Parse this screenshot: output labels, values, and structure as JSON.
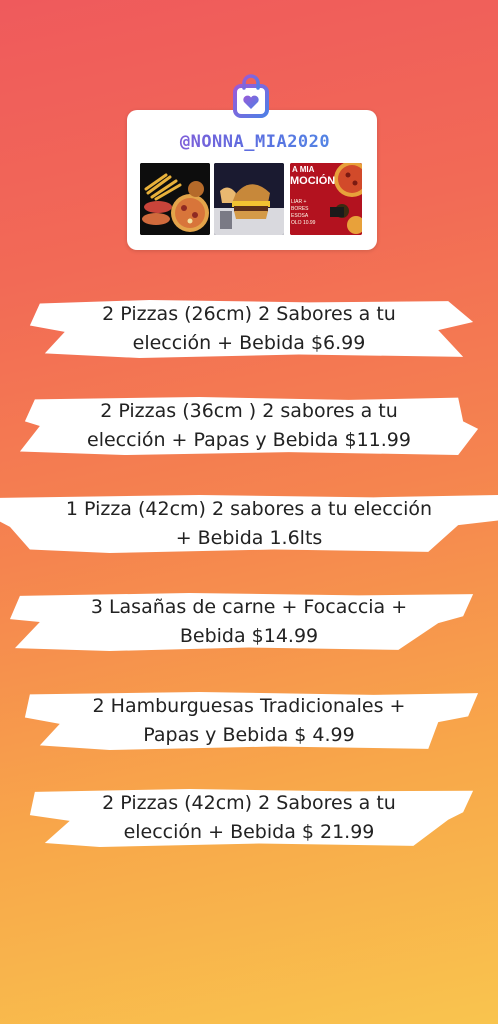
{
  "sticker": {
    "handle": "@NONNA_MIA2020",
    "images": [
      {
        "name": "fries-and-pizza-photo"
      },
      {
        "name": "hamburger-photo"
      },
      {
        "name": "promo-flyer",
        "label_top": "A MIA",
        "label_main": "MOCIÓN",
        "small_lines": [
          "LIAR +",
          "BORES",
          "ESOSA",
          "OLO 10.99"
        ]
      }
    ],
    "icon": "shopping-bag-heart-icon"
  },
  "offers": [
    {
      "lines": [
        "2 Pizzas (26cm) 2 Sabores a tu",
        "elección + Bebida  $6.99"
      ]
    },
    {
      "lines": [
        "2 Pizzas (36cm ) 2 sabores a tu",
        "elección + Papas y Bebida  $11.99"
      ]
    },
    {
      "lines": [
        "1 Pizza (42cm) 2 sabores a tu elección",
        "+ Bebida 1.6lts"
      ]
    },
    {
      "lines": [
        "3 Lasañas de carne + Focaccia +",
        "Bebida $14.99"
      ]
    },
    {
      "lines": [
        "2 Hamburguesas Tradicionales +",
        "Papas y Bebida $ 4.99"
      ]
    },
    {
      "lines": [
        "2 Pizzas (42cm) 2 Sabores a tu",
        "elección + Bebida $ 21.99"
      ]
    }
  ],
  "colors": {
    "gradient_top": "#ef5a5c",
    "gradient_bottom": "#f9c44e",
    "handle_gradient_start": "#8e57d6",
    "handle_gradient_end": "#4f8ee6"
  }
}
